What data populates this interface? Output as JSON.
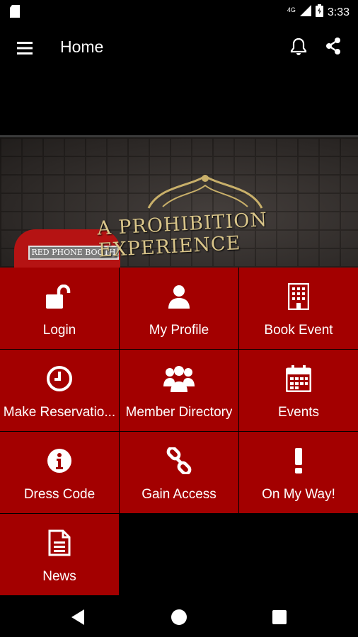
{
  "status_bar": {
    "network": "4G",
    "time": "3:33"
  },
  "app_bar": {
    "title": "Home"
  },
  "hero": {
    "headline": "A PROHIBITION EXPERIENCE",
    "sign_text": "RED PHONE BOOTH"
  },
  "tiles": [
    {
      "label": "Login",
      "icon": "unlock-icon"
    },
    {
      "label": "My Profile",
      "icon": "user-icon"
    },
    {
      "label": "Book Event",
      "icon": "building-icon"
    },
    {
      "label": "Make Reservatio...",
      "icon": "clock-icon"
    },
    {
      "label": "Member Directory",
      "icon": "group-icon"
    },
    {
      "label": "Events",
      "icon": "calendar-icon"
    },
    {
      "label": "Dress Code",
      "icon": "info-icon"
    },
    {
      "label": "Gain Access",
      "icon": "link-icon"
    },
    {
      "label": "On My Way!",
      "icon": "exclamation-icon"
    },
    {
      "label": "News",
      "icon": "document-icon"
    }
  ],
  "colors": {
    "tile": "#a30000",
    "background": "#000000"
  }
}
